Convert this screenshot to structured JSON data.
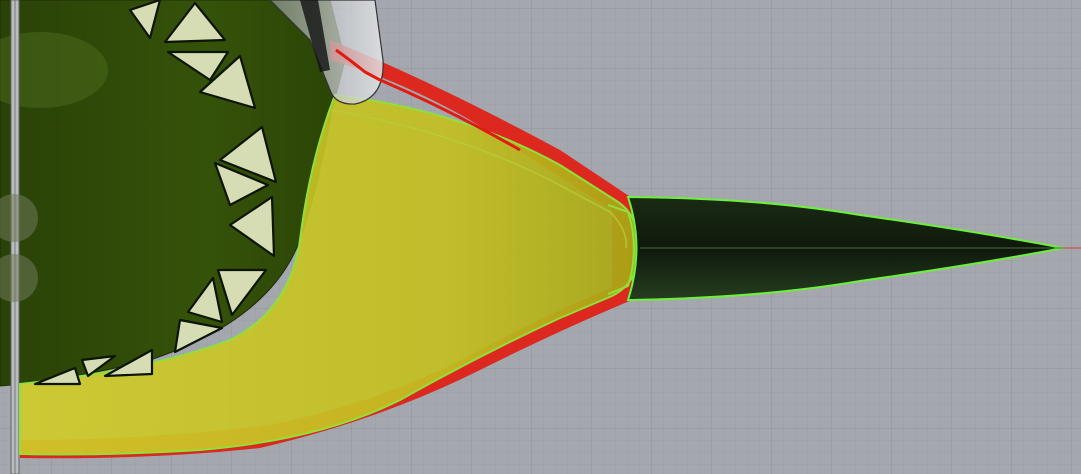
{
  "viewport": {
    "background_color": "#a4a8ae",
    "grid_minor_color": "#9aa0a6",
    "grid_major_color": "#8e949b",
    "x_axis_color": "#d84040"
  },
  "model": {
    "body_fill_color": "#2f4a08",
    "body_shadow_color": "#243a06",
    "skirt_fill_color": "#c9c72a",
    "skirt_outline_color": "#8fe03a",
    "bottom_shell_color": "#e21a10",
    "nose_cone_fill_color": "#1e3118",
    "nose_cone_outline_color": "#6cf03c",
    "cutout_fill_color": "#d6ddb4",
    "cutout_outline_color": "#0c1404",
    "canopy_fill_color": "#c9ccd0"
  }
}
